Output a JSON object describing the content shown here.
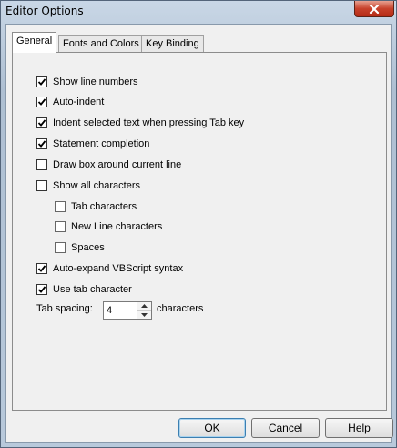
{
  "window": {
    "title": "Editor Options"
  },
  "tabs": [
    {
      "label": "General",
      "active": true
    },
    {
      "label": "Fonts and Colors",
      "active": false
    },
    {
      "label": "Key Binding",
      "active": false
    }
  ],
  "options": [
    {
      "label": "Show line numbers",
      "checked": true
    },
    {
      "label": "Auto-indent",
      "checked": true
    },
    {
      "label": "Indent selected text when pressing Tab key",
      "checked": true
    },
    {
      "label": "Statement completion",
      "checked": true
    },
    {
      "label": "Draw box around current line",
      "checked": false
    },
    {
      "label": "Show all characters",
      "checked": false
    },
    {
      "label": "Tab characters",
      "checked": false
    },
    {
      "label": "New Line characters",
      "checked": false
    },
    {
      "label": "Spaces",
      "checked": false
    },
    {
      "label": "Auto-expand VBScript syntax",
      "checked": true
    },
    {
      "label": "Use tab character",
      "checked": true
    }
  ],
  "tab_spacing": {
    "label": "Tab spacing:",
    "value": "4",
    "units": "characters"
  },
  "buttons": {
    "ok": "OK",
    "cancel": "Cancel",
    "help": "Help"
  },
  "colors": {
    "close_button": "#c7412b",
    "default_button_border": "#3c7fb1"
  }
}
